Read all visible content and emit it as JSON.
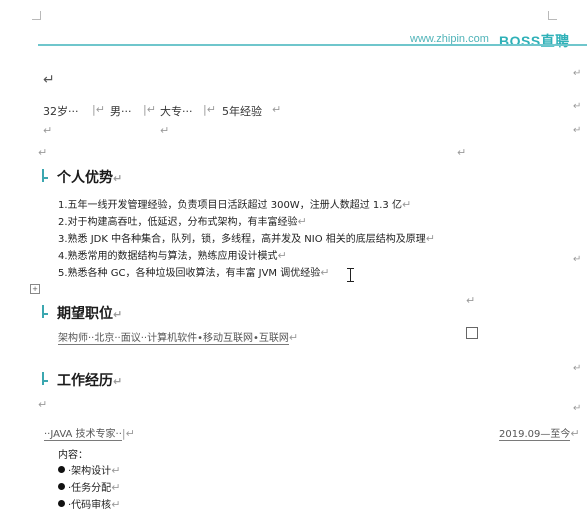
{
  "header": {
    "url": "www.zhipin.com",
    "brand": "BOSS直聘"
  },
  "marks": {
    "para": "↵",
    "ret": "↵"
  },
  "profile": {
    "age": "32岁···",
    "gender": "男···",
    "edu": "大专···",
    "experience": "5年经验"
  },
  "sections": {
    "advantages_title": "个人优势",
    "advantages": [
      "1.五年一线开发管理经验，负责项目日活跃超过 300W，注册人数超过 1.3 亿",
      "2.对于构建高吞吐，低延迟，分布式架构，有丰富经验",
      "3.熟悉 JDK 中各种集合，队列，锁，多线程，高并发及 NIO 相关的底层结构及原理",
      "4.熟悉常用的数据结构与算法，熟练应用设计模式",
      "5.熟悉各种 GC，各种垃圾回收算法，有丰富 JVM 调优经验"
    ],
    "expect_title": "期望职位",
    "expect_line": "架构师··北京··面议··计算机软件•移动互联网•互联网",
    "work_title": "工作经历",
    "job_title": "··JAVA 技术专家··",
    "job_date": "2019.09—至今",
    "content_label": "内容：",
    "duties": [
      "·架构设计",
      "·任务分配",
      "·代码审核"
    ]
  }
}
